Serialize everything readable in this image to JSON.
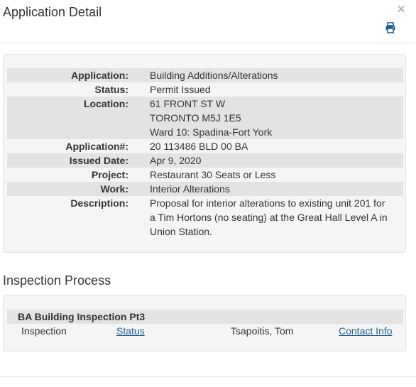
{
  "modal": {
    "title": "Application Detail",
    "close_glyph": "×",
    "print_icon": "printer-icon"
  },
  "detail": {
    "rows": [
      {
        "label": "Application:",
        "lines": [
          "Building Additions/Alterations"
        ]
      },
      {
        "label": "Status:",
        "lines": [
          "Permit Issued"
        ]
      },
      {
        "label": "Location:",
        "lines": [
          "61 FRONT ST W",
          "TORONTO M5J 1E5",
          "Ward 10: Spadina-Fort York"
        ]
      },
      {
        "label": "Application#:",
        "lines": [
          "20 113486 BLD 00 BA"
        ]
      },
      {
        "label": "Issued Date:",
        "lines": [
          "Apr 9, 2020"
        ]
      },
      {
        "label": "Project:",
        "lines": [
          "Restaurant 30 Seats or Less"
        ]
      },
      {
        "label": "Work:",
        "lines": [
          "Interior Alterations"
        ]
      },
      {
        "label": "Description:",
        "lines": [
          "Proposal for interior alterations to existing unit 201 for a Tim Hortons (no seating) at the Great Hall Level A in Union Station."
        ]
      }
    ]
  },
  "inspection": {
    "section_title": "Inspection Process",
    "group_title": "BA Building Inspection Pt3",
    "row": {
      "label": "Inspection",
      "status_link": "Status",
      "inspector": "Tsapoitis, Tom",
      "contact_link": "Contact Info"
    }
  },
  "colors": {
    "link": "#1f5e92",
    "panel_bg": "#f5f5f5",
    "row_stripe": "#e3e3e3",
    "icon": "#1f5e92"
  }
}
